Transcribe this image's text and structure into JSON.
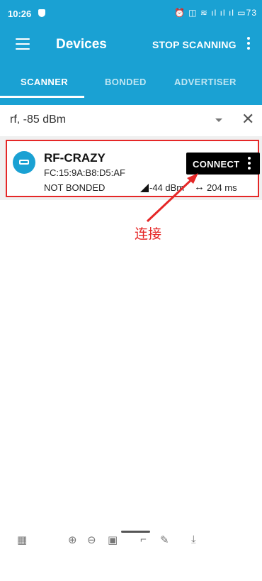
{
  "status": {
    "time": "10:26",
    "icons": "⏰ ◫ ≋ ıl ıl ıl ▭73"
  },
  "toolbar": {
    "title": "Devices",
    "action": "STOP SCANNING"
  },
  "tabs": [
    {
      "label": "SCANNER"
    },
    {
      "label": "BONDED"
    },
    {
      "label": "ADVERTISER"
    }
  ],
  "filter": {
    "text": "rf, -85 dBm"
  },
  "device": {
    "name": "RF-CRAZY",
    "address": "FC:15:9A:B8:D5:AF",
    "bond_state": "NOT BONDED",
    "rssi": "-44 dBm",
    "interval": "204 ms",
    "connect_label": "CONNECT"
  },
  "annotation": {
    "text": "连接"
  },
  "colors": {
    "brand": "#1aa1d3",
    "highlight": "#e52727"
  },
  "bottom_icons": [
    "grid-icon",
    "zoom-in-icon",
    "zoom-out-icon",
    "fit-icon",
    "rotate-icon",
    "edit-icon",
    "download-icon"
  ]
}
